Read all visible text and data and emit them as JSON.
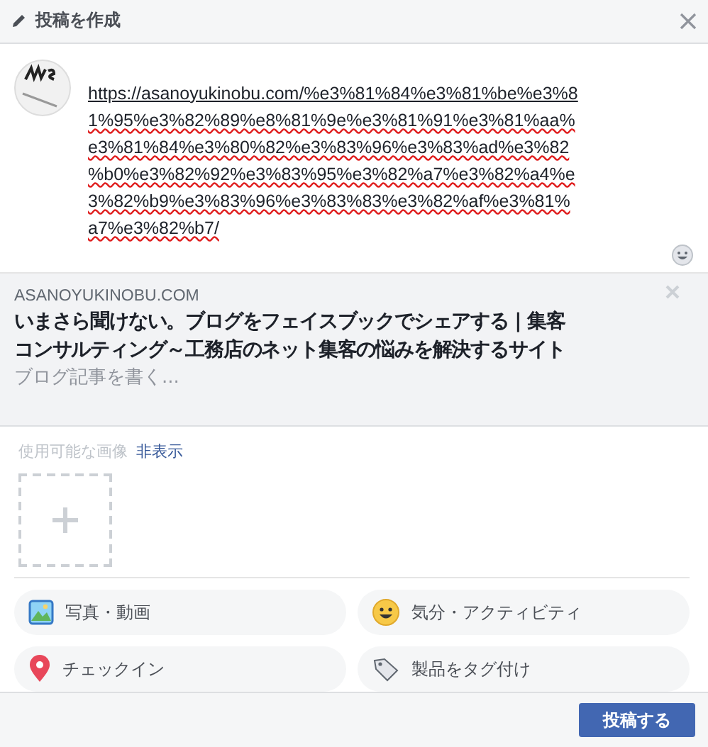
{
  "header": {
    "title": "投稿を作成"
  },
  "composer": {
    "lines": [
      "https://asanoyukinobu.com/%e3%81%84%e3%81%be%e3%8",
      "1%95%e3%82%89%e8%81%9e%e3%81%91%e3%81%aa%",
      "e3%81%84%e3%80%82%e3%83%96%e3%83%ad%e3%82",
      "%b0%e3%82%92%e3%83%95%e3%82%a7%e3%82%a4%e",
      "3%82%b9%e3%83%96%e3%83%83%e3%82%af%e3%81%",
      "a7%e3%82%b7/"
    ]
  },
  "preview": {
    "domain": "ASANOYUKINOBU.COM",
    "title_lines": [
      "いまさら聞けない。ブログをフェイスブックでシェアする | 集客",
      "コンサルティング～工務店のネット集客の悩みを解決するサイト"
    ],
    "description": "ブログ記事を書く..."
  },
  "images": {
    "label": "使用可能な画像",
    "toggle": "非表示"
  },
  "actions": [
    {
      "kind": "photo",
      "label": "写真・動画"
    },
    {
      "kind": "feeling",
      "label": "気分・アクティビティ"
    },
    {
      "kind": "checkin",
      "label": "チェックイン"
    },
    {
      "kind": "tag",
      "label": "製品をタグ付け"
    }
  ],
  "footer": {
    "button": "投稿する"
  }
}
